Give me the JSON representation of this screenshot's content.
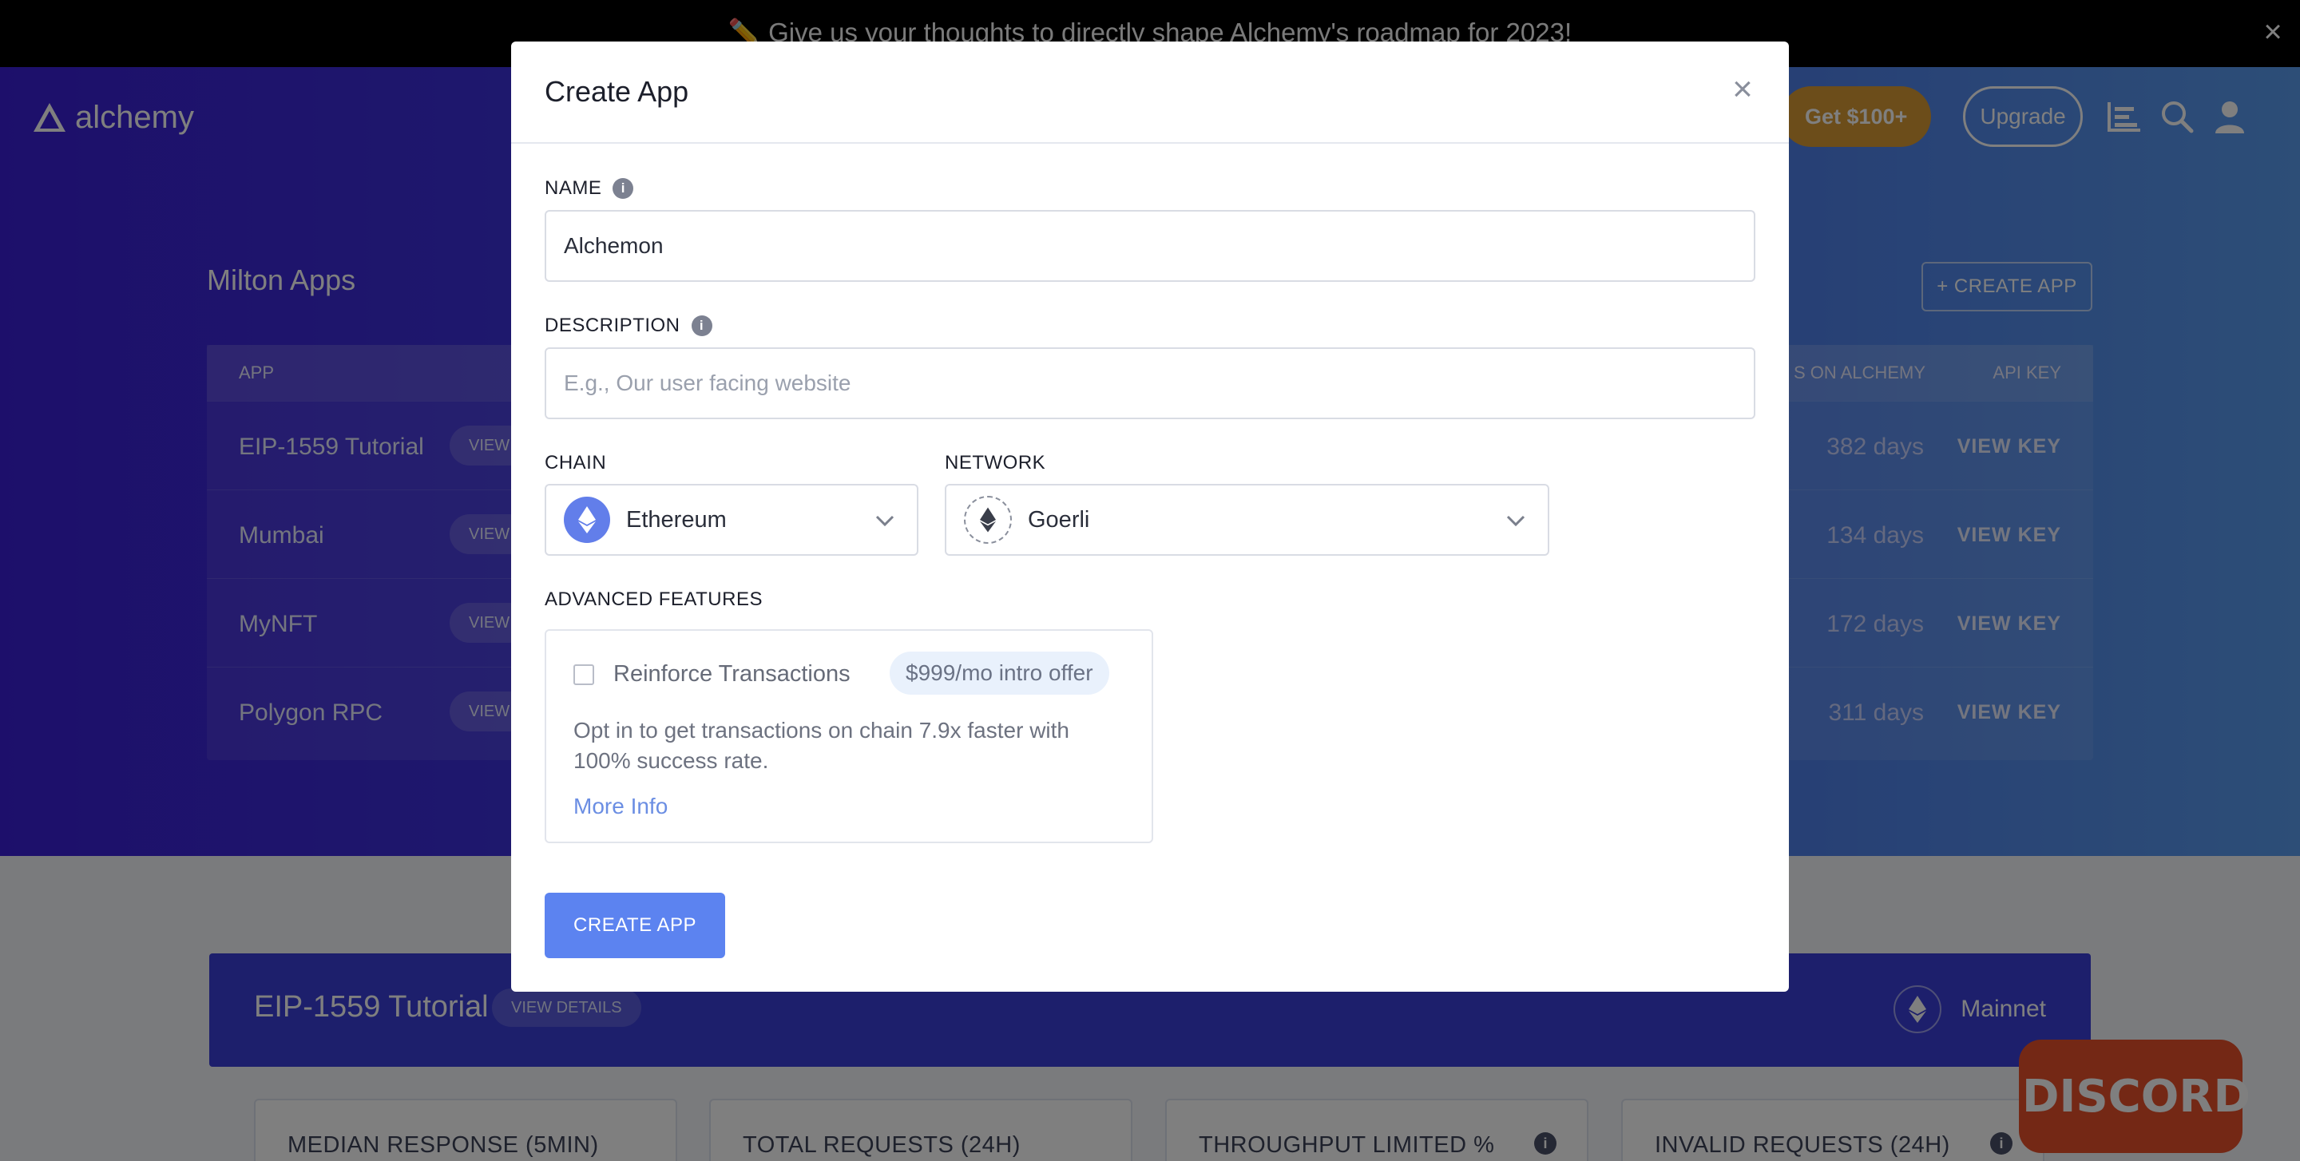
{
  "announcement": {
    "text": "✏️ Give us your thoughts to directly shape Alchemy's roadmap for 2023!",
    "close_label": "×"
  },
  "header": {
    "logo_text": "alchemy",
    "get_button": "Get $100+",
    "upgrade_button": "Upgrade",
    "icons": [
      "chart-icon",
      "search-icon",
      "user-icon"
    ]
  },
  "apps_section": {
    "title": "Milton Apps",
    "create_button": "+ CREATE APP",
    "columns": [
      "APP",
      "S ON ALCHEMY",
      "API KEY"
    ],
    "rows": [
      {
        "name": "EIP-1559 Tutorial",
        "view": "VIEW",
        "days": "382 days",
        "key": "VIEW KEY"
      },
      {
        "name": "Mumbai",
        "view": "VIEW",
        "days": "134 days",
        "key": "VIEW KEY"
      },
      {
        "name": "MyNFT",
        "view": "VIEW",
        "days": "172 days",
        "key": "VIEW KEY"
      },
      {
        "name": "Polygon RPC",
        "view": "VIEW",
        "days": "311 days",
        "key": "VIEW KEY"
      }
    ]
  },
  "app_detail": {
    "title": "EIP-1559 Tutorial",
    "view_details": "VIEW DETAILS",
    "network": "Mainnet",
    "stats": [
      "MEDIAN RESPONSE (5MIN)",
      "TOTAL REQUESTS (24H)",
      "THROUGHPUT LIMITED %",
      "INVALID REQUESTS (24H)"
    ]
  },
  "discord": {
    "label": "DISCORD"
  },
  "modal": {
    "title": "Create App",
    "close_label": "×",
    "name_label": "NAME",
    "name_value": "Alchemon",
    "description_label": "DESCRIPTION",
    "description_placeholder": "E.g., Our user facing website",
    "chain_label": "CHAIN",
    "chain_value": "Ethereum",
    "network_label": "NETWORK",
    "network_value": "Goerli",
    "advanced_label": "ADVANCED FEATURES",
    "reinforce_label": "Reinforce Transactions",
    "reinforce_checked": false,
    "offer_badge": "$999/mo intro offer",
    "reinforce_desc": "Opt in to get transactions on chain 7.9x faster with 100% success rate.",
    "more_info": "More Info",
    "submit_label": "CREATE APP"
  },
  "colors": {
    "accent": "#5c83f0",
    "hero_start": "#3b1fd6",
    "hero_end": "#5a9cef",
    "get_button": "#d99a34",
    "discord": "#e8512a"
  }
}
